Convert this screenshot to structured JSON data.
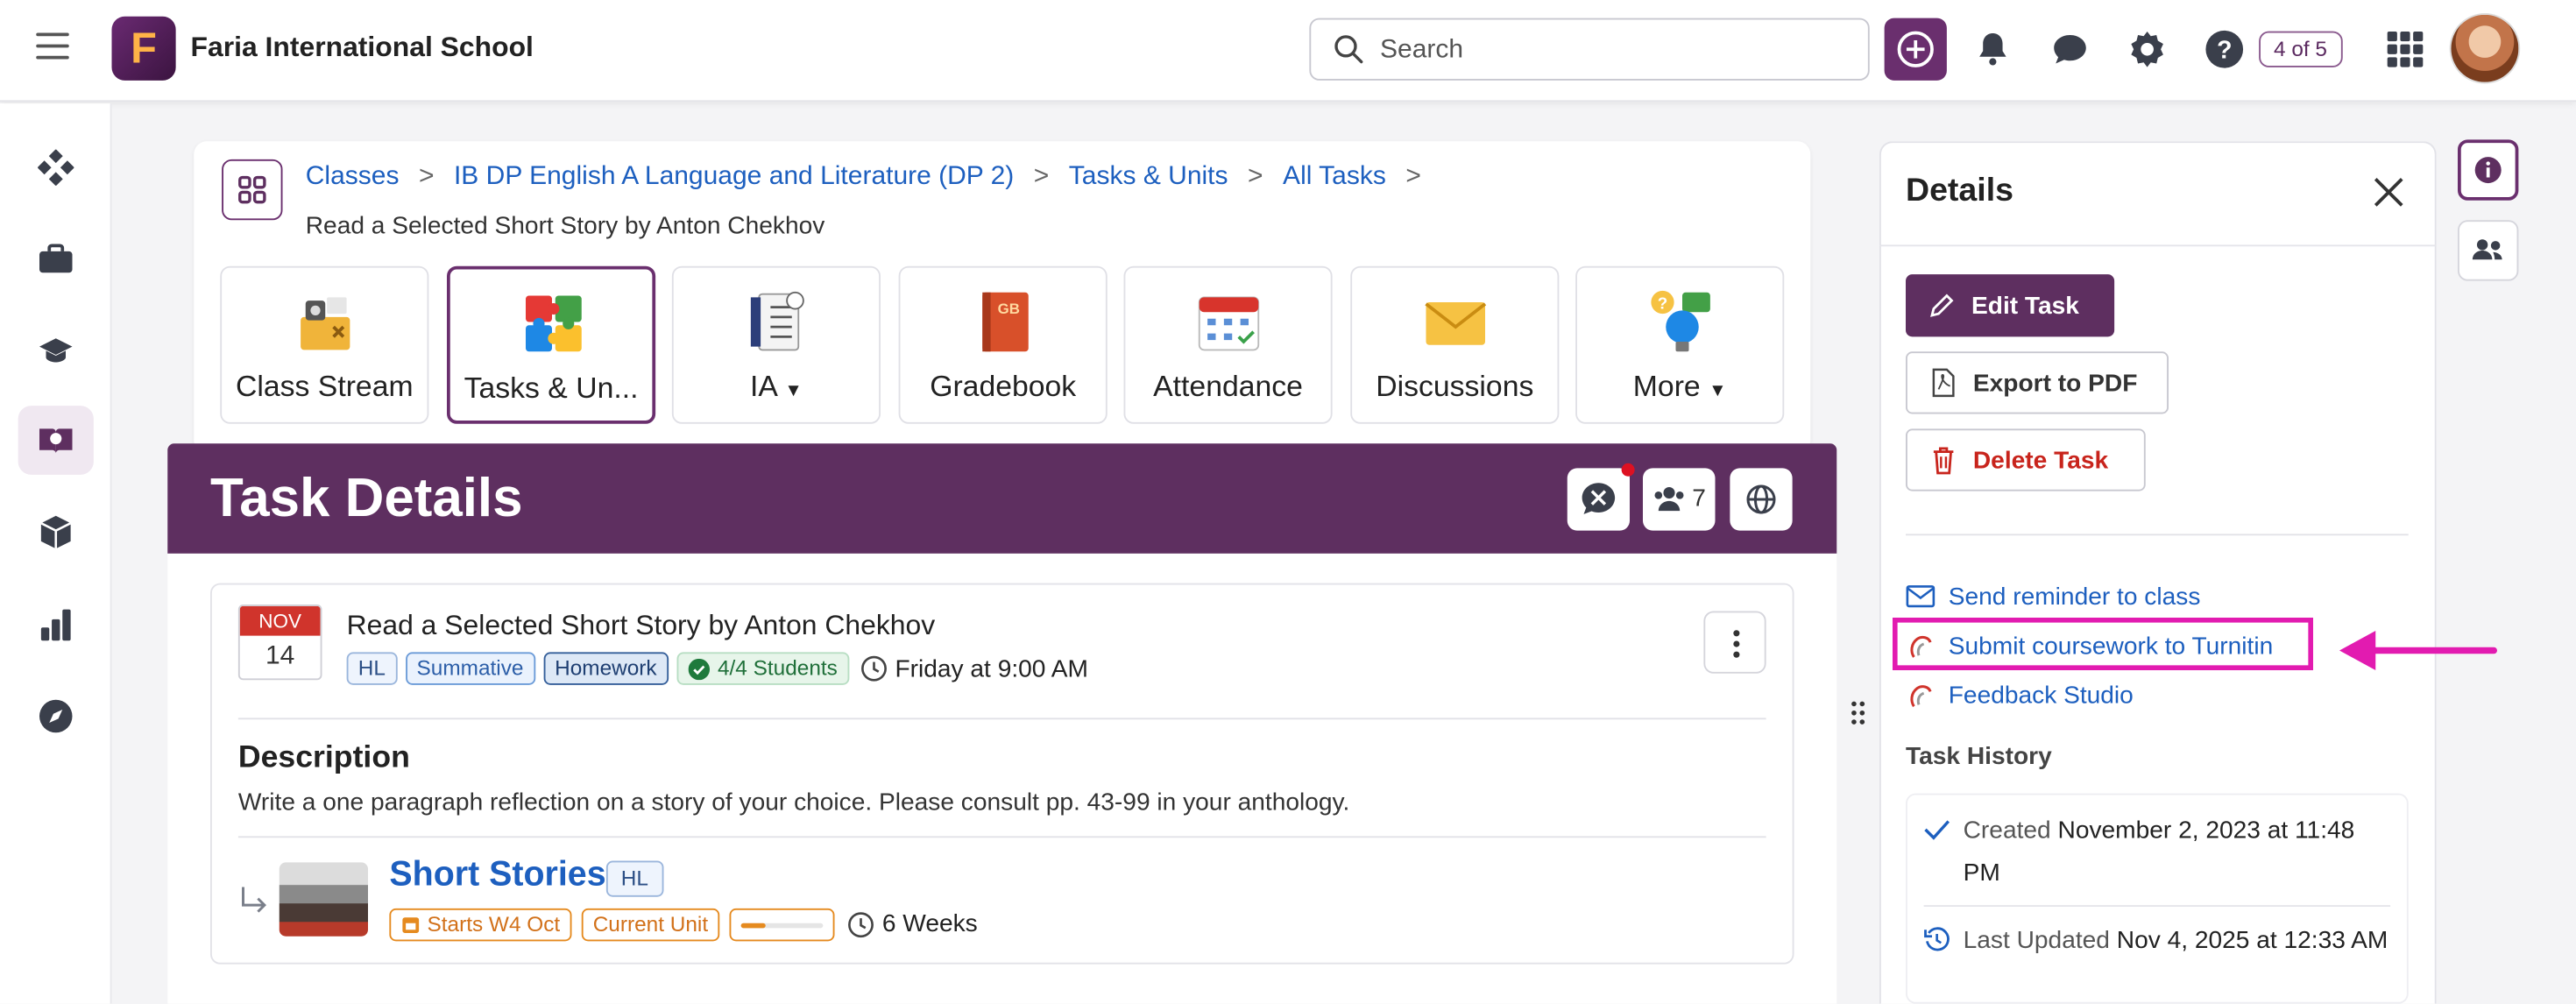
{
  "app": {
    "logo_letter": "F",
    "school_name": "Faria International School",
    "search_placeholder": "Search",
    "pager": "4 of 5"
  },
  "breadcrumb": {
    "items": [
      "Classes",
      "IB DP English A Language and Literature (DP 2)",
      "Tasks & Units",
      "All Tasks"
    ],
    "current": "Read a Selected Short Story by Anton Chekhov"
  },
  "tiles": [
    {
      "label": "Class Stream",
      "icon": "class-stream-icon"
    },
    {
      "label": "Tasks & Un...",
      "icon": "puzzle-icon",
      "active": true
    },
    {
      "label": "IA",
      "icon": "checklist-icon",
      "dropdown": true
    },
    {
      "label": "Gradebook",
      "icon": "gradebook-icon",
      "badge": "GB"
    },
    {
      "label": "Attendance",
      "icon": "calendar-icon"
    },
    {
      "label": "Discussions",
      "icon": "envelope-icon"
    },
    {
      "label": "More",
      "icon": "lightbulb-icon",
      "dropdown": true
    }
  ],
  "task_header": {
    "title": "Task Details",
    "participant_count": "7"
  },
  "task": {
    "date_month": "NOV",
    "date_day": "14",
    "title": "Read a Selected Short Story by Anton Chekhov",
    "tags": {
      "level": "HL",
      "type": "Summative",
      "kind": "Homework",
      "students": "4/4 Students"
    },
    "due": "Friday at 9:00 AM",
    "description_heading": "Description",
    "description": "Write a one paragraph reflection on a story of your choice. Please consult pp. 43-99 in your anthology."
  },
  "unit": {
    "title": "Short Stories",
    "level": "HL",
    "starts": "Starts W4 Oct",
    "status": "Current Unit",
    "progress": 0.3,
    "duration": "6 Weeks"
  },
  "details_panel": {
    "title": "Details",
    "edit_label": "Edit Task",
    "export_label": "Export to PDF",
    "delete_label": "Delete Task",
    "links": {
      "reminder": "Send reminder to class",
      "turnitin": "Submit coursework to Turnitin",
      "feedback": "Feedback Studio"
    },
    "history_heading": "Task History",
    "created_label": "Created",
    "created_value": "November 2, 2023 at 11:48 PM",
    "updated_label": "Last Updated",
    "updated_value": "Nov 4, 2025 at 12:33 AM"
  },
  "colors": {
    "brand": "#5e2f60",
    "link": "#1d5fbf",
    "highlight": "#e21bb0",
    "danger": "#c8241c",
    "unit_orange": "#e58a1f"
  }
}
